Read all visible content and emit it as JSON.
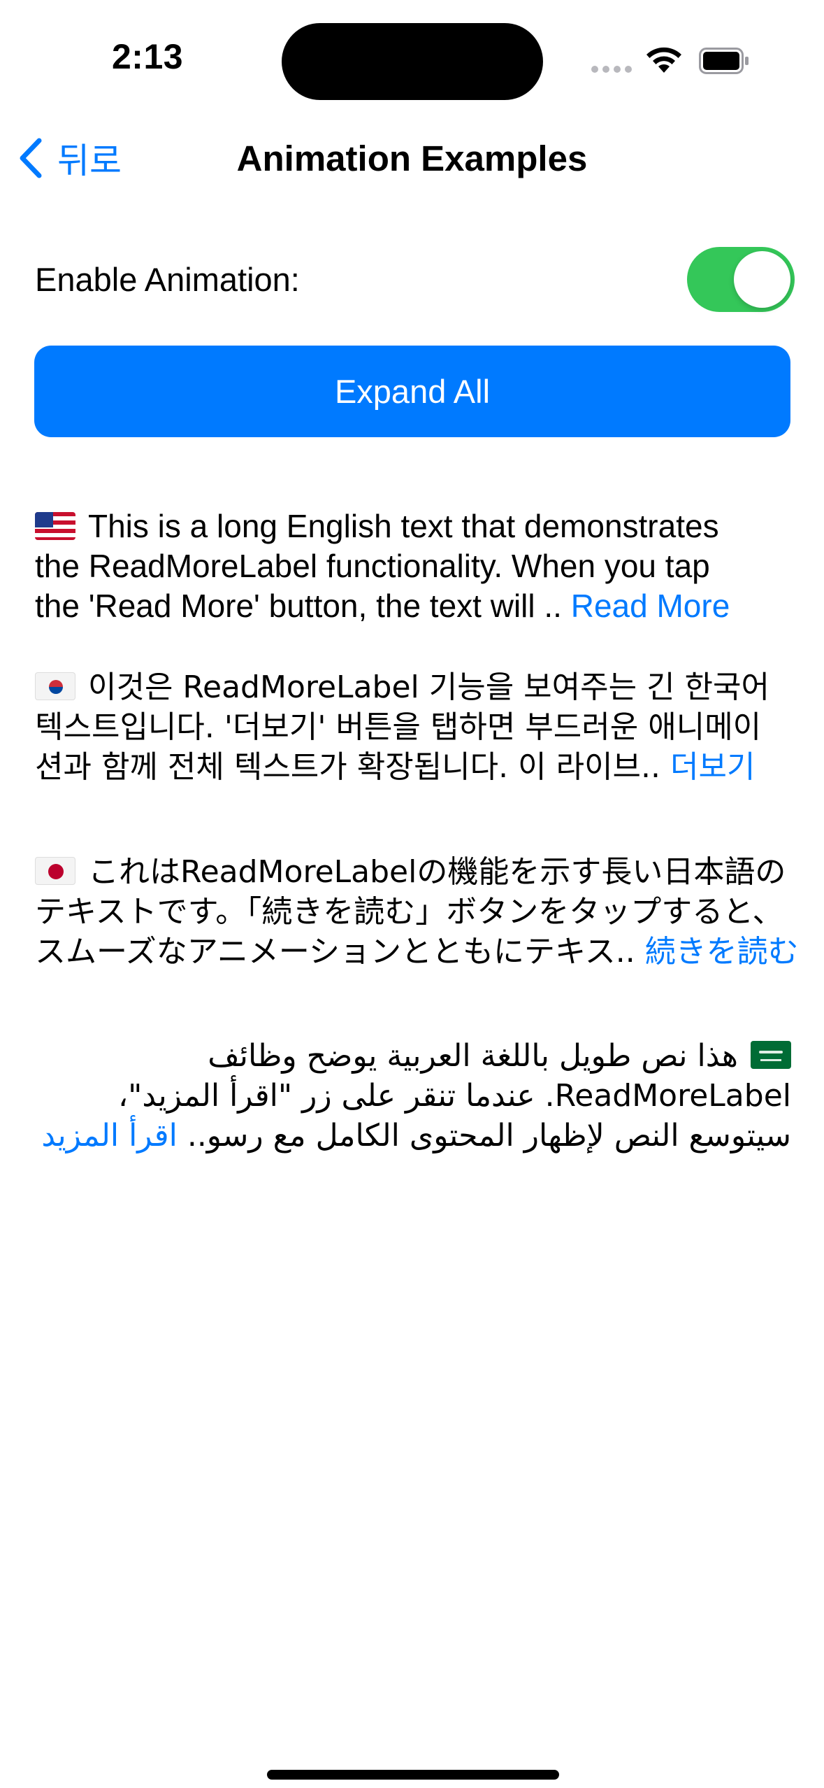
{
  "status_bar": {
    "time": "2:13"
  },
  "nav": {
    "back_label": "뒤로",
    "title": "Animation Examples"
  },
  "settings": {
    "animation_label": "Enable Animation:",
    "animation_enabled": true,
    "expand_button_label": "Expand All"
  },
  "colors": {
    "accent": "#007aff",
    "toggle_on": "#34c759"
  },
  "examples": [
    {
      "flag": "us-flag-icon",
      "lines": [
        "This is a long English text that demonstrates",
        "the ReadMoreLabel functionality. When you tap",
        "the 'Read More' button, the text will .. "
      ],
      "more": "Read More"
    },
    {
      "flag": "kr-flag-icon",
      "lines": [
        "이것은 ReadMoreLabel 기능을 보여주는 긴 한국어",
        "텍스트입니다. '더보기' 버튼을 탭하면 부드러운 애니메이",
        "션과 함께 전체 텍스트가 확장됩니다. 이 라이브.. "
      ],
      "more": "더보기"
    },
    {
      "flag": "jp-flag-icon",
      "lines": [
        "これはReadMoreLabelの機能を示す長い日本語の",
        "テキストです。「続きを読む」ボタンをタップすると、",
        "スムーズなアニメーションとともにテキス.. "
      ],
      "more": "続きを読む"
    },
    {
      "flag": "sa-flag-icon",
      "lines": [
        "هذا نص طويل باللغة العربية يوضح وظائف",
        "ReadMoreLabel. عندما تنقر على زر \"اقرأ المزيد\"،",
        "سيتوسع النص لإظهار المحتوى الكامل مع رسو.. "
      ],
      "more": "اقرأ المزيد"
    }
  ]
}
